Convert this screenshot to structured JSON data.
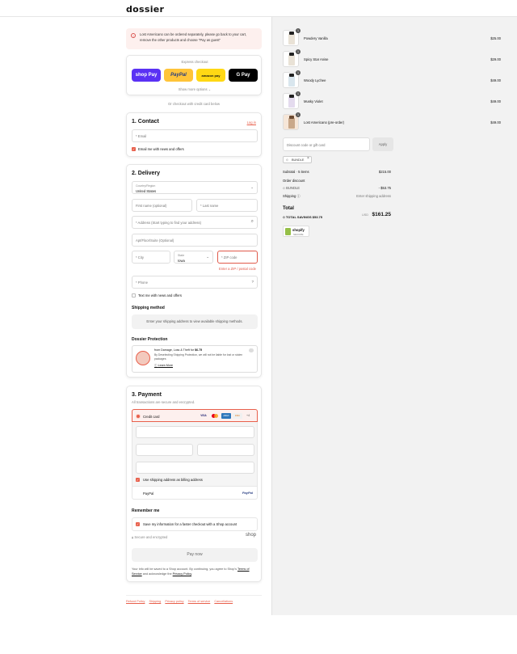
{
  "brand": {
    "logo": "dossier",
    "accent": "#e8604c"
  },
  "notice": {
    "text": "Lost Americano can be ordered separately, please go back to your cart, remove the other products and choose \"Pay as guest\""
  },
  "express": {
    "title": "Express checkout",
    "buttons": {
      "shop": "shop Pay",
      "paypal": "PayPal",
      "amazon": "amazon pay",
      "gpay": "G Pay"
    },
    "show_more": "Show more options ⌄",
    "or": "Or checkout with credit card below"
  },
  "contact": {
    "title": "1. Contact",
    "login": "Log in",
    "email_placeholder": "* Email",
    "email_offers": "Email me with news and offers"
  },
  "delivery": {
    "title": "2. Delivery",
    "country_label": "Country/Region",
    "country_value": "United States",
    "first_name": "First name (optional)",
    "last_name": "* Last name",
    "address": "* Address (Start typing to find your address)",
    "apt": "Apt/Floor/Suite (Optional)",
    "city": "* City",
    "state_label": "State",
    "state_value": "Iowa",
    "zip": "* ZIP code",
    "zip_error": "Enter a ZIP / postal code",
    "phone": "* Phone",
    "text_offers": "Text me with news and offers",
    "shipping_method_title": "Shipping method",
    "shipping_method_note": "Enter your shipping address to view available shipping methods.",
    "protection_title": "Dossier Protection",
    "protection_line1_prefix": "from Damage, Loss & Theft for ",
    "protection_price": "$6.75",
    "protection_line2": "By Deselecting Shipping Protection, we will not be liable for lost or stolen packages",
    "learn_more": "Learn More"
  },
  "payment": {
    "title": "3. Payment",
    "subtitle": "All transactions are secure and encrypted.",
    "credit_card": "Credit card",
    "card_brands": [
      "VISA",
      "MC",
      "AMEX",
      "DISC"
    ],
    "more_cards": "+4",
    "use_shipping": "Use shipping address as billing address",
    "paypal": "PayPal",
    "paypal_logo": "PayPal",
    "remember_title": "Remember me",
    "save_info": "Save my information for a faster checkout with a Shop account",
    "secure": "Secure and encrypted",
    "shop_logo": "shop",
    "pay_now": "Pay now",
    "legal_prefix": "Your info will be saved to a Shop account. By continuing, you agree to Shop's ",
    "legal_terms": "Terms of Service",
    "legal_mid": " and acknowledge the ",
    "legal_privacy": "Privacy Policy",
    "legal_end": "."
  },
  "footer": {
    "links": [
      "Refund Policy",
      "Shipping",
      "Privacy policy",
      "Terms of service",
      "Cancellations"
    ]
  },
  "summary": {
    "items": [
      {
        "qty": "1",
        "name": "Powdery Vanilla",
        "price": "$25.00"
      },
      {
        "qty": "1",
        "name": "Spicy Star Anise",
        "price": "$29.00"
      },
      {
        "qty": "1",
        "name": "Woody Lychee",
        "price": "$49.00"
      },
      {
        "qty": "1",
        "name": "Musky Violet",
        "price": "$49.00"
      },
      {
        "qty": "1",
        "name": "Lost Americano (pre-order)",
        "price": "$49.00"
      }
    ],
    "discount_placeholder": "Discount code or gift card",
    "apply": "Apply",
    "bundle_tag": "BUNDLE",
    "subtotal_label": "Subtotal · 5 items",
    "subtotal_value": "$215.00",
    "order_discount_label": "Order discount",
    "bundle_label": "BUNDLE",
    "bundle_value": "- $53.75",
    "shipping_label": "Shipping",
    "shipping_value": "Enter shipping address",
    "total_label": "Total",
    "currency": "USD",
    "total_value": "$161.25",
    "savings_label": "TOTAL SAVINGS",
    "savings_value": "$53.75",
    "badge_text": "shopify",
    "badge_sub": "SECURE"
  }
}
